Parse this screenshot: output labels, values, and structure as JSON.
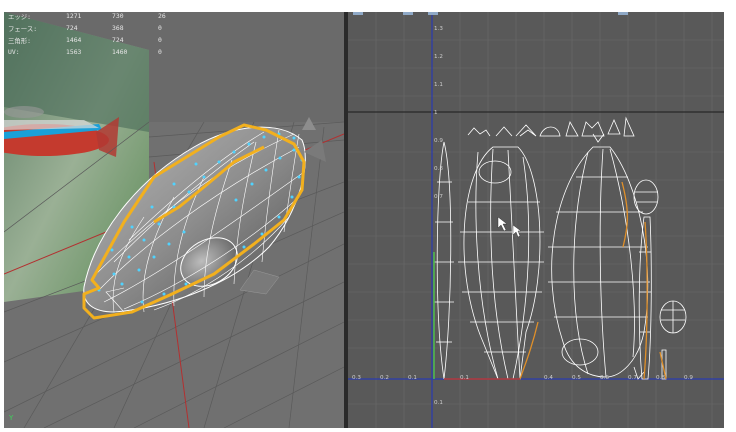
{
  "stats": [
    {
      "label": "エッジ:",
      "v1": "1271",
      "v2": "730",
      "v3": "26"
    },
    {
      "label": "フェース:",
      "v1": "724",
      "v2": "368",
      "v3": "0"
    },
    {
      "label": "三角形:",
      "v1": "1464",
      "v2": "724",
      "v3": "0"
    },
    {
      "label": "UV:",
      "v1": "1563",
      "v2": "1460",
      "v3": "0"
    }
  ],
  "axis_indicator": "Y",
  "uv_axis": {
    "x_ticks": [
      "0.3",
      "0.2",
      "0.1",
      "0.1",
      "0.4",
      "0.5",
      "0.6",
      "0.7",
      "0.8",
      "0.9"
    ],
    "y_ticks_top": [
      "1.3",
      "1.2",
      "1.1",
      "1",
      "0.9",
      "0.8",
      "0.7"
    ],
    "y_ticks_bottom": [
      "0.1"
    ]
  },
  "colors": {
    "viewport_bg": "#6c6c6c",
    "uv_bg": "#595959",
    "selection_orange": "#f2b01e",
    "wireframe_white": "#ffffff",
    "vertex_cyan": "#4fd3ff",
    "grid_red": "#b33030",
    "uv_axis_blue": "#2a3bb0"
  },
  "icons": [
    "y-axis-indicator-icon"
  ]
}
